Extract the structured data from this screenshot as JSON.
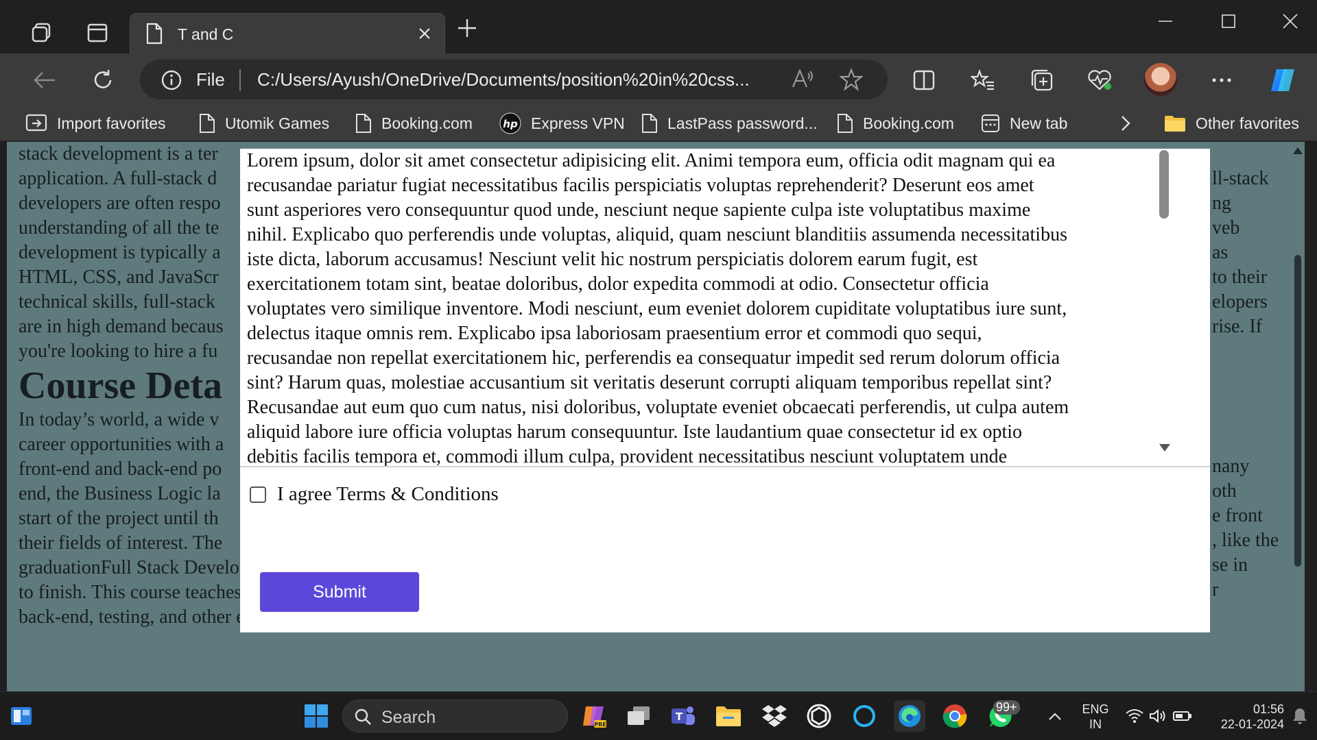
{
  "browser": {
    "tab_title": "T and C",
    "address_scheme": "File",
    "address_url": "C:/Users/Ayush/OneDrive/Documents/position%20in%20css...",
    "favorites": [
      {
        "label": "Import favorites",
        "icon": "import-icon"
      },
      {
        "label": "Utomik Games",
        "icon": "page-icon"
      },
      {
        "label": "Booking.com",
        "icon": "page-icon"
      },
      {
        "label": "Express VPN",
        "icon": "hp-logo-icon"
      },
      {
        "label": "LastPass password...",
        "icon": "page-icon"
      },
      {
        "label": "Booking.com",
        "icon": "page-icon"
      },
      {
        "label": "New tab",
        "icon": "newtab-icon"
      }
    ],
    "other_favorites": "Other favorites"
  },
  "page": {
    "bg_lines_top": [
      "stack development is a ter",
      "application. A full-stack d",
      "developers are often respo",
      "understanding of all the te",
      "development is typically a",
      "HTML, CSS, and JavaScr",
      "technical skills, full-stack",
      "are in high demand becaus",
      "you're looking to hire a fu"
    ],
    "bg_right_top": [
      "",
      "ll-stack",
      "ng",
      "veb",
      "as",
      "to their",
      "elopers",
      "rise. If",
      ""
    ],
    "heading": "Course Deta",
    "bg_lines_bottom": [
      "In today’s world, a wide v",
      "career opportunities with a",
      "front-end and back-end po",
      "end, the Business Logic la",
      "start of the project until th",
      "their fields of interest. The"
    ],
    "bg_right_bottom": [
      "nany",
      "oth",
      "e front",
      ", like the",
      "se in",
      "r"
    ],
    "bg_full_lines": [
      "graduationFull Stack Developer course educates students on the fundamentals behind the design. It aims to develop complete websites from scratch",
      "to finish. This course teaches about the different aspects of web development and its functionalities such as databases, version control, front-end,",
      "back-end, testing, and other essential technological parameters.Web Development is highly lucrative, and a step forward with the Full-stack Web"
    ]
  },
  "modal": {
    "terms_lines": [
      "Lorem ipsum, dolor sit amet consectetur adipisicing elit. Animi tempora eum, officia odit magnam qui ea",
      "recusandae pariatur fugiat necessitatibus facilis perspiciatis voluptas reprehenderit? Deserunt eos amet",
      "sunt asperiores vero consequuntur quod unde, nesciunt neque sapiente culpa iste voluptatibus maxime",
      "nihil. Explicabo quo perferendis unde voluptas, aliquid, quam nesciunt blanditiis assumenda necessitatibus",
      "iste dicta, laborum accusamus! Nesciunt velit hic nostrum perspiciatis dolorem earum fugit, est",
      "exercitationem totam sint, beatae doloribus, dolor expedita commodi at odio. Consectetur officia",
      "voluptates vero similique inventore. Modi nesciunt, eum eveniet dolorem cupiditate voluptatibus iure sunt,",
      "delectus itaque omnis rem. Explicabo ipsa laboriosam praesentium error et commodi quo sequi,",
      "recusandae non repellat exercitationem hic, perferendis ea consequatur impedit sed rerum dolorum officia",
      "sint? Harum quas, molestiae accusantium sit veritatis deserunt corrupti aliquam temporibus repellat sint?",
      "Recusandae aut eum quo cum natus, nisi doloribus, voluptate eveniet obcaecati perferendis, ut culpa autem",
      "aliquid labore iure officia voluptas harum consequuntur. Iste laudantium quae consectetur id ex optio",
      "debitis facilis tempora et, commodi illum culpa, provident necessitatibus nesciunt voluptatem unde"
    ],
    "agree_label": "I agree Terms & Conditions",
    "agree_checked": false,
    "submit_label": "Submit",
    "submit_color": "#5b48db"
  },
  "taskbar": {
    "search_label": "Search",
    "whatsapp_badge": "99+",
    "language": "ENG",
    "region": "IN",
    "time": "01:56",
    "date": "22-01-2024"
  }
}
